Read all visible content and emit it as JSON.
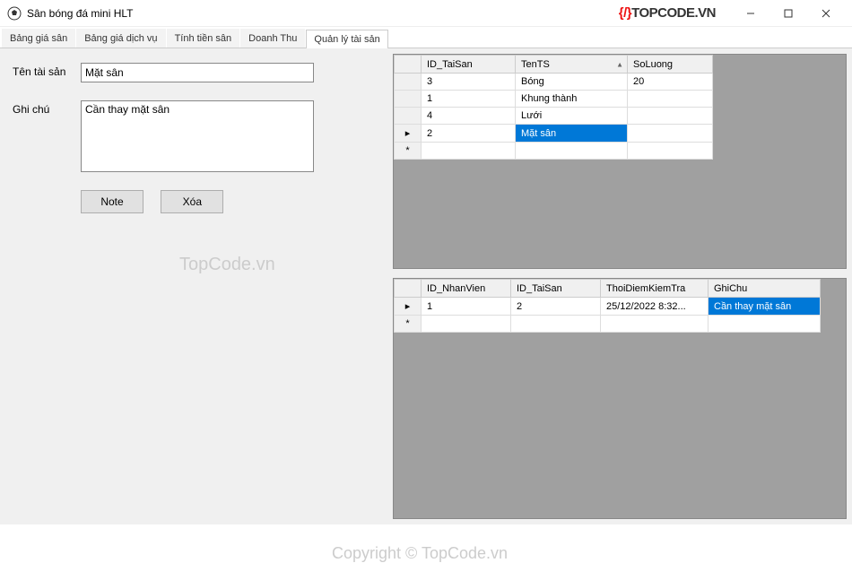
{
  "window": {
    "title": "Sân bóng đá mini HLT",
    "brand_text": "TOPCODE.VN"
  },
  "tabs": [
    {
      "label": "Bảng giá sân"
    },
    {
      "label": "Bảng giá dịch vụ"
    },
    {
      "label": "Tính tiền sân"
    },
    {
      "label": "Doanh Thu"
    },
    {
      "label": "Quản lý tài sản"
    }
  ],
  "form": {
    "name_label": "Tên tài sản",
    "name_value": "Mặt sân",
    "note_label": "Ghi chú",
    "note_value": "Cần thay mặt sân",
    "note_btn": "Note",
    "delete_btn": "Xóa"
  },
  "watermarks": {
    "wm1": "TopCode.vn",
    "wm2": "Copyright © TopCode.vn"
  },
  "grid_assets": {
    "headers": [
      "ID_TaiSan",
      "TenTS",
      "SoLuong"
    ],
    "rows": [
      {
        "marker": "",
        "ID_TaiSan": "3",
        "TenTS": "Bóng",
        "SoLuong": "20",
        "selected_col": null
      },
      {
        "marker": "",
        "ID_TaiSan": "1",
        "TenTS": "Khung thành",
        "SoLuong": "",
        "selected_col": null
      },
      {
        "marker": "",
        "ID_TaiSan": "4",
        "TenTS": "Lưới",
        "SoLuong": "",
        "selected_col": null
      },
      {
        "marker": "▸",
        "ID_TaiSan": "2",
        "TenTS": "Mặt sân",
        "SoLuong": "",
        "selected_col": "TenTS"
      },
      {
        "marker": "*",
        "ID_TaiSan": "",
        "TenTS": "",
        "SoLuong": "",
        "selected_col": null
      }
    ]
  },
  "grid_checks": {
    "headers": [
      "ID_NhanVien",
      "ID_TaiSan",
      "ThoiDiemKiemTra",
      "GhiChu"
    ],
    "rows": [
      {
        "marker": "▸",
        "ID_NhanVien": "1",
        "ID_TaiSan": "2",
        "ThoiDiemKiemTra": "25/12/2022 8:32...",
        "GhiChu": "Cần thay mặt sân",
        "selected_col": "GhiChu"
      },
      {
        "marker": "*",
        "ID_NhanVien": "",
        "ID_TaiSan": "",
        "ThoiDiemKiemTra": "",
        "GhiChu": "",
        "selected_col": null
      }
    ]
  }
}
